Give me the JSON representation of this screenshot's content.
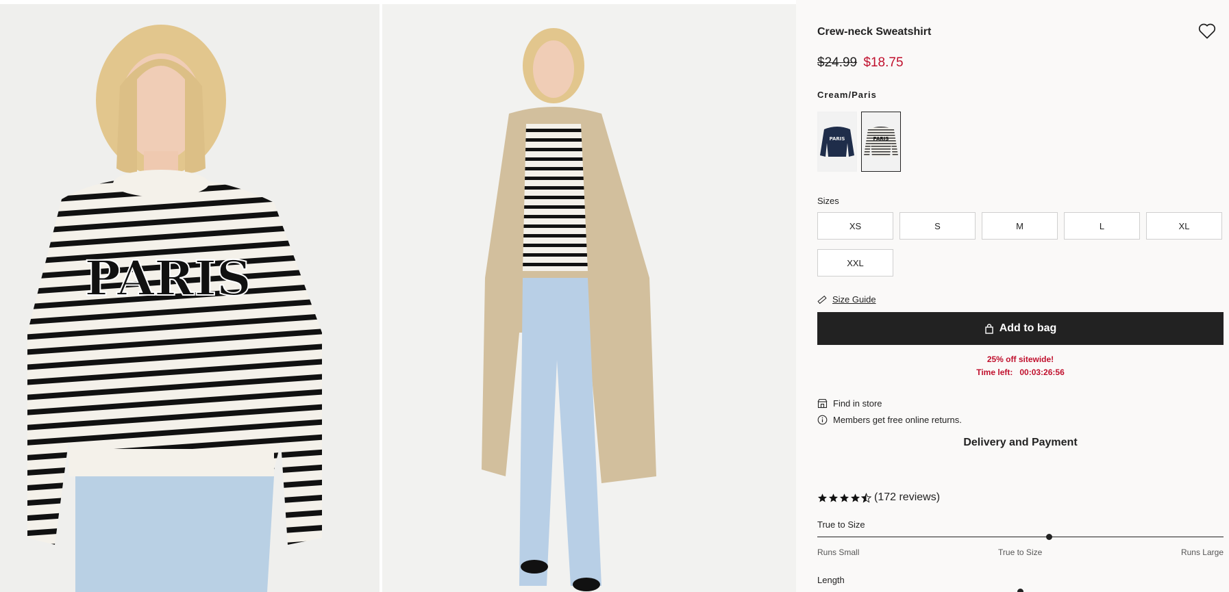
{
  "product": {
    "title": "Crew-neck Sweatshirt",
    "price_old": "$24.99",
    "price_new": "$18.75",
    "color_name": "Cream/Paris",
    "swatches": [
      {
        "name": "navy-paris",
        "print": "PARIS"
      },
      {
        "name": "cream-paris-striped",
        "print": "PARIS"
      }
    ]
  },
  "photos": {
    "front_print": "PARIS"
  },
  "sizes": {
    "label": "Sizes",
    "options": [
      "XS",
      "S",
      "M",
      "L",
      "XL",
      "XXL"
    ]
  },
  "size_guide": "Size Guide",
  "add_to_bag": "Add to bag",
  "promo": {
    "line1": "25% off sitewide!",
    "time_label": "Time left:",
    "time_value": "00:03:26:56"
  },
  "find_in_store": "Find in store",
  "members_returns": "Members get free online returns.",
  "delivery": "Delivery and Payment",
  "reviews": {
    "rating": 4.5,
    "count_text": "(172 reviews)"
  },
  "fit": {
    "label": "True to Size",
    "position": 0.57,
    "scale": [
      "Runs Small",
      "True to Size",
      "Runs Large"
    ]
  },
  "length": {
    "label": "Length"
  },
  "colors": {
    "sale": "#c0102d",
    "button": "#222222"
  },
  "icons": [
    "heart-icon",
    "ruler-icon",
    "bag-icon",
    "store-icon",
    "info-icon",
    "star-icon"
  ]
}
